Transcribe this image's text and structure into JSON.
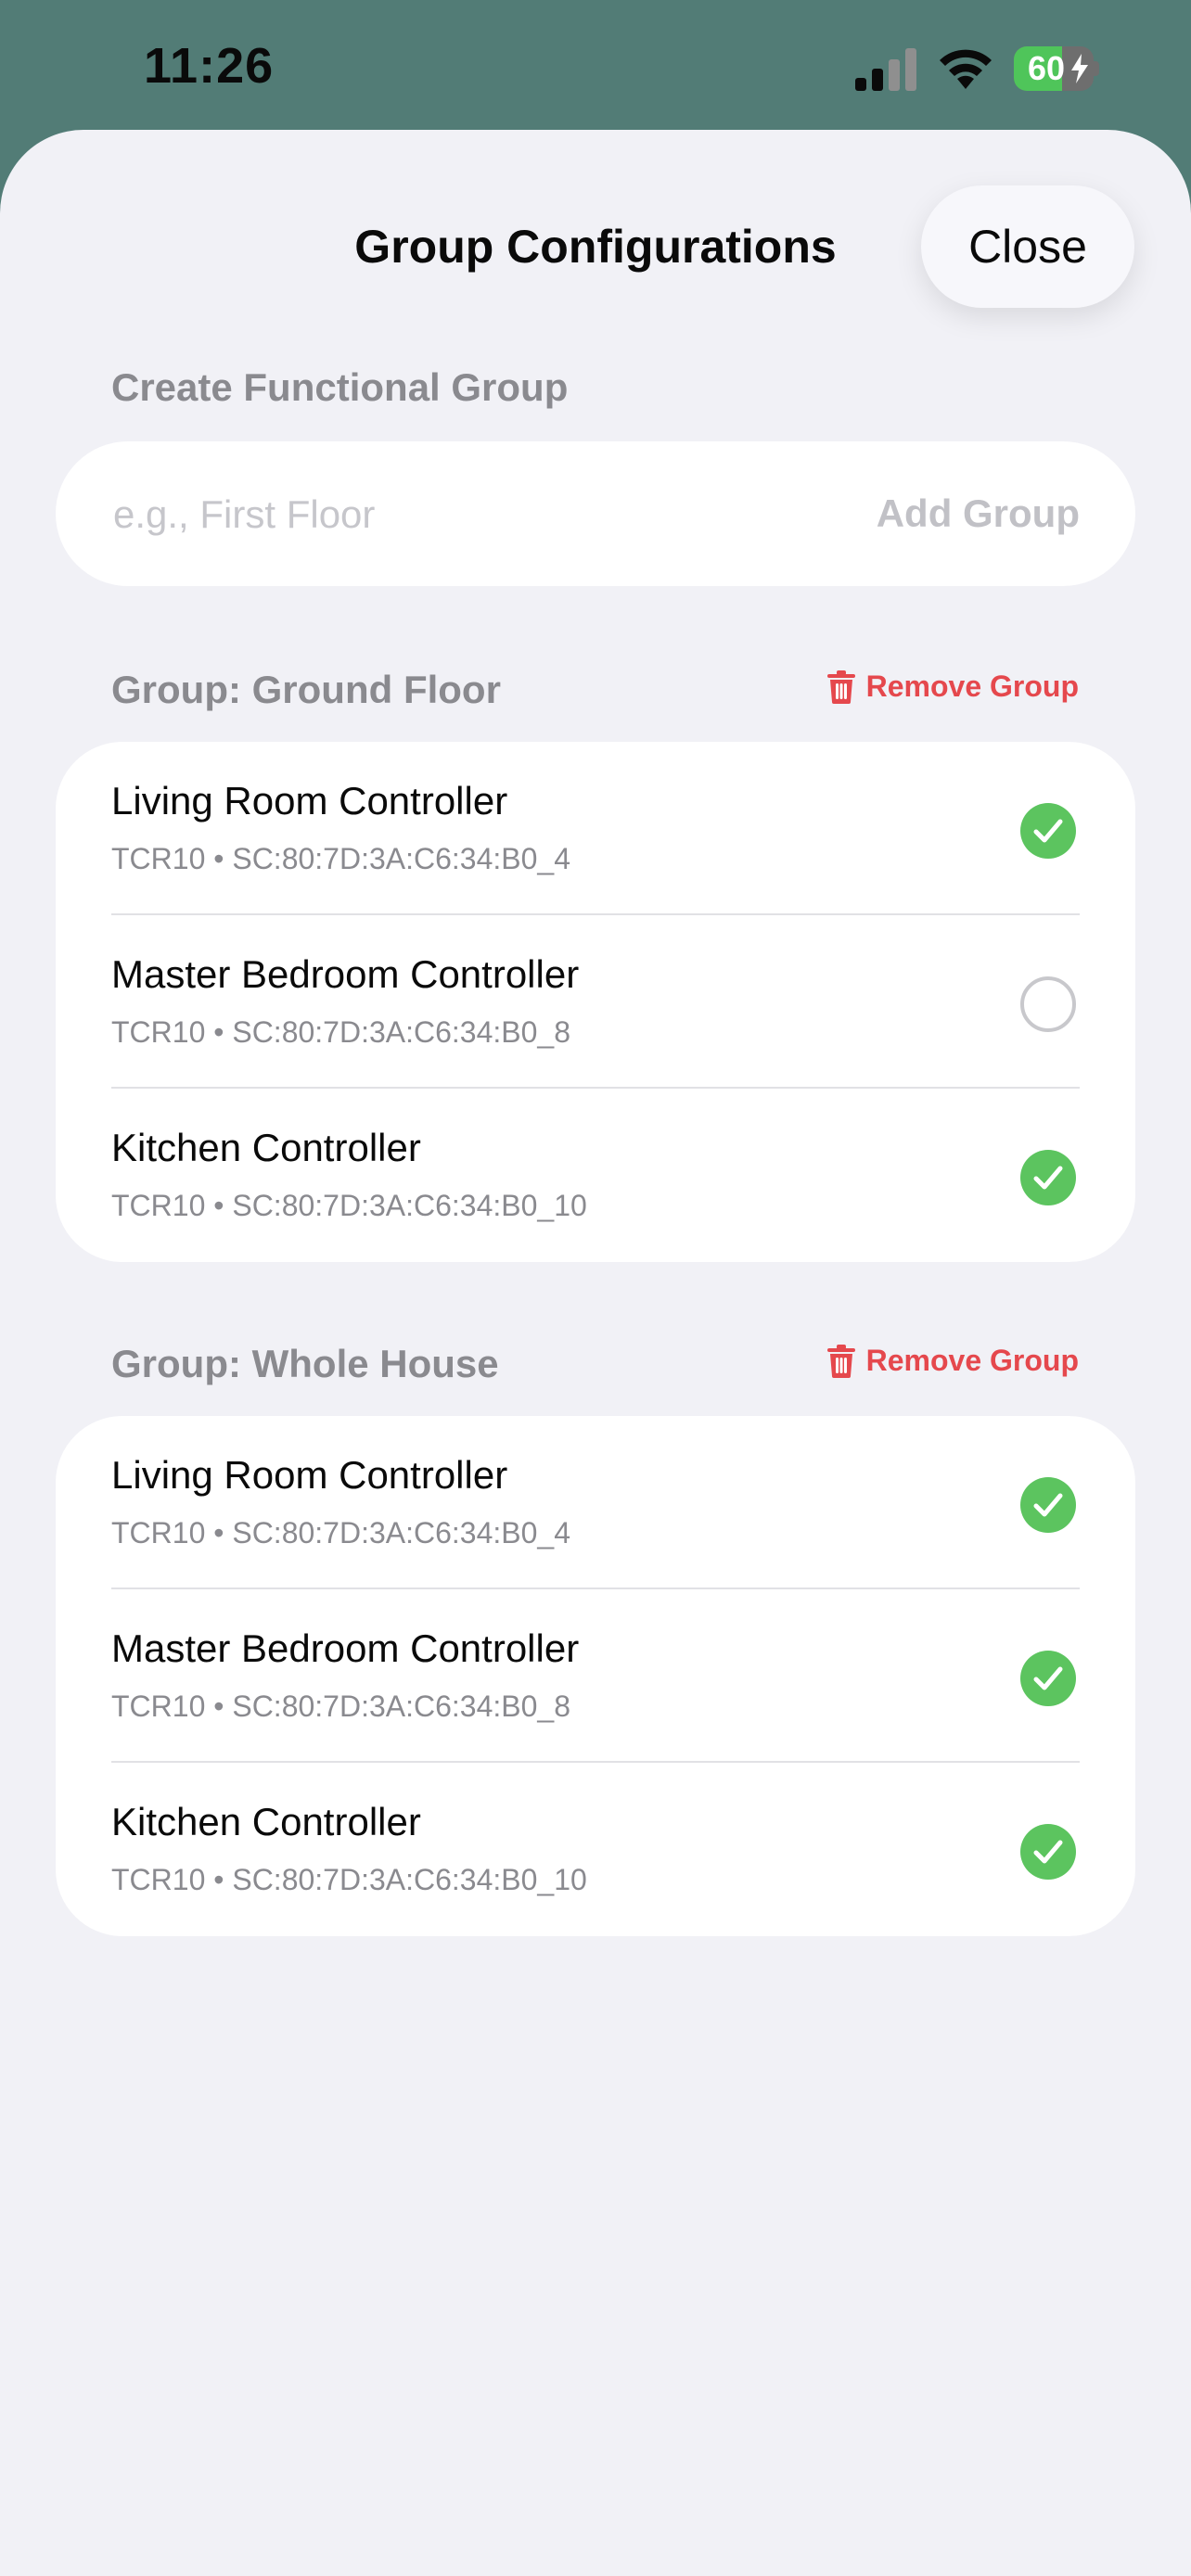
{
  "status_bar": {
    "time": "11:26",
    "battery_percent": "60",
    "battery_level": 0.6,
    "icons": [
      "signal-icon",
      "wifi-icon",
      "battery-icon",
      "charging-bolt-icon"
    ]
  },
  "sheet": {
    "title": "Group Configurations",
    "close_label": "Close"
  },
  "create": {
    "header": "Create Functional Group",
    "placeholder": "e.g., First Floor",
    "value": "",
    "add_label": "Add Group"
  },
  "colors": {
    "backdrop": "#527c76",
    "sheet": "#f1f1f6",
    "check_on": "#5cc45f",
    "remove": "#e5484d"
  },
  "groups": [
    {
      "header": "Group: Ground Floor",
      "remove_label": "Remove Group",
      "items": [
        {
          "name": "Living Room Controller",
          "detail": "TCR10 • SC:80:7D:3A:C6:34:B0_4",
          "selected": true
        },
        {
          "name": "Master Bedroom Controller",
          "detail": "TCR10 • SC:80:7D:3A:C6:34:B0_8",
          "selected": false
        },
        {
          "name": "Kitchen Controller",
          "detail": "TCR10 • SC:80:7D:3A:C6:34:B0_10",
          "selected": true
        }
      ]
    },
    {
      "header": "Group: Whole House",
      "remove_label": "Remove Group",
      "items": [
        {
          "name": "Living Room Controller",
          "detail": "TCR10 • SC:80:7D:3A:C6:34:B0_4",
          "selected": true
        },
        {
          "name": "Master Bedroom Controller",
          "detail": "TCR10 • SC:80:7D:3A:C6:34:B0_8",
          "selected": true
        },
        {
          "name": "Kitchen Controller",
          "detail": "TCR10 • SC:80:7D:3A:C6:34:B0_10",
          "selected": true
        }
      ]
    }
  ]
}
